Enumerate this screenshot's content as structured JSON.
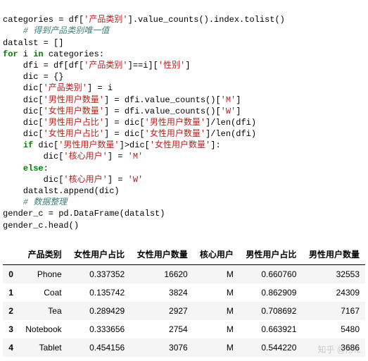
{
  "code": {
    "l1a": "categories = df[",
    "l1b": "'产品类别'",
    "l1c": "].value_counts().index.tolist()",
    "l2": "    # 得到产品类别唯一值",
    "l3": "datalst = []",
    "l4a": "for",
    "l4b": " i ",
    "l4c": "in",
    "l4d": " categories:",
    "l5a": "    dfi = df[df[",
    "l5b": "'产品类别'",
    "l5c": "]==i][",
    "l5d": "'性别'",
    "l5e": "]",
    "l6": "    dic = {}",
    "l7a": "    dic[",
    "l7b": "'产品类别'",
    "l7c": "] = i",
    "l8a": "    dic[",
    "l8b": "'男性用户数量'",
    "l8c": "] = dfi.value_counts()[",
    "l8d": "'M'",
    "l8e": "]",
    "l9a": "    dic[",
    "l9b": "'女性用户数量'",
    "l9c": "] = dfi.value_counts()[",
    "l9d": "'W'",
    "l9e": "]",
    "l10a": "    dic[",
    "l10b": "'男性用户占比'",
    "l10c": "] = dic[",
    "l10d": "'男性用户数量'",
    "l10e": "]/len(dfi)",
    "l11a": "    dic[",
    "l11b": "'女性用户占比'",
    "l11c": "] = dic[",
    "l11d": "'女性用户数量'",
    "l11e": "]/len(dfi)",
    "l12a": "    ",
    "l12b": "if",
    "l12c": " dic[",
    "l12d": "'男性用户数量'",
    "l12e": "]>dic[",
    "l12f": "'女性用户数量'",
    "l12g": "]:",
    "l13a": "        dic[",
    "l13b": "'核心用户'",
    "l13c": "] = ",
    "l13d": "'M'",
    "l14a": "    ",
    "l14b": "else",
    "l14c": ":",
    "l15a": "        dic[",
    "l15b": "'核心用户'",
    "l15c": "] = ",
    "l15d": "'W'",
    "l16": "    datalst.append(dic)",
    "l17": "    # 数据整理",
    "l18": "gender_c = pd.DataFrame(datalst)",
    "l19": "gender_c.head()"
  },
  "table": {
    "headers": [
      "",
      "产品类别",
      "女性用户占比",
      "女性用户数量",
      "核心用户",
      "男性用户占比",
      "男性用户数量"
    ],
    "rows": [
      [
        "0",
        "Phone",
        "0.337352",
        "16620",
        "M",
        "0.660760",
        "32553"
      ],
      [
        "1",
        "Coat",
        "0.135742",
        "3824",
        "M",
        "0.862909",
        "24309"
      ],
      [
        "2",
        "Tea",
        "0.289429",
        "2927",
        "M",
        "0.708692",
        "7167"
      ],
      [
        "3",
        "Notebook",
        "0.333656",
        "2754",
        "M",
        "0.663921",
        "5480"
      ],
      [
        "4",
        "Tablet",
        "0.454156",
        "3076",
        "M",
        "0.544220",
        "3686"
      ]
    ]
  },
  "watermark": "知乎 @彤IL"
}
